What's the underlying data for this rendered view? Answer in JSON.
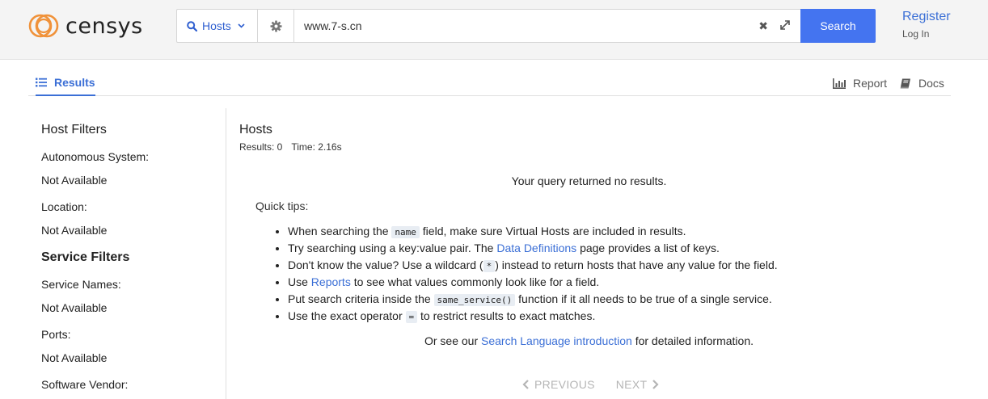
{
  "brand": {
    "name": "censys",
    "ring_color": "#f0923a"
  },
  "search": {
    "type_label": "Hosts",
    "query": "www.7-s.cn",
    "clear_glyph": "✖",
    "button_label": "Search"
  },
  "auth": {
    "register_label": "Register",
    "login_label": "Log In"
  },
  "tabs": {
    "results": "Results",
    "report": "Report",
    "docs": "Docs"
  },
  "sidebar": {
    "host_filters": "Host Filters",
    "autonomous_system_label": "Autonomous System:",
    "autonomous_system_value": "Not Available",
    "location_label": "Location:",
    "location_value": "Not Available",
    "service_filters": "Service Filters",
    "service_names_label": "Service Names:",
    "service_names_value": "Not Available",
    "ports_label": "Ports:",
    "ports_value": "Not Available",
    "software_vendor_label": "Software Vendor:"
  },
  "main": {
    "title": "Hosts",
    "results_stat": "Results: 0",
    "time_stat": "Time: 2.16s",
    "no_results": "Your query returned no results.",
    "tips_title": "Quick tips:",
    "tip1": {
      "a": "When searching the ",
      "code": "name",
      "b": " field, make sure Virtual Hosts are included in results."
    },
    "tip2": {
      "a": "Try searching using a key:value pair. The ",
      "link": "Data Definitions",
      "b": " page provides a list of keys."
    },
    "tip3": {
      "a": "Don't know the value? Use a wildcard (",
      "code": "*",
      "b": ") instead to return hosts that have any value for the field."
    },
    "tip4": {
      "a": "Use ",
      "link": "Reports",
      "b": " to see what values commonly look like for a field."
    },
    "tip5": {
      "a": "Put search criteria inside the ",
      "code": "same_service()",
      "b": " function if it all needs to be true of a single service."
    },
    "tip6": {
      "a": "Use the exact operator ",
      "code": "=",
      "b": " to restrict results to exact matches."
    },
    "see_our": {
      "a": "Or see our ",
      "link": "Search Language introduction",
      "b": " for detailed information."
    },
    "previous": "PREVIOUS",
    "next": "NEXT"
  },
  "colors": {
    "accent": "#3b6fd6",
    "search_button": "#4474f0"
  }
}
